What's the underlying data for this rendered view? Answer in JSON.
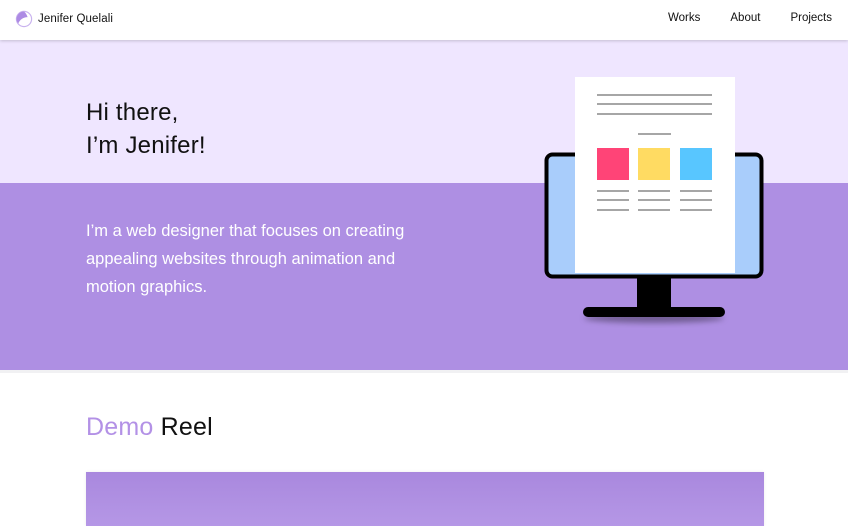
{
  "brand": {
    "name": "Jenifer Quelali",
    "logo_icon": "moon-logo-icon"
  },
  "nav": {
    "links": [
      "Works",
      "About",
      "Projects"
    ]
  },
  "hero": {
    "greeting_line1": "Hi there,",
    "greeting_line2": "I’m Jenifer!",
    "intro": "I’m a web designer that focuses on creating appealing websites through animation and motion graphics.",
    "illustration_icon": "monitor-document-icon"
  },
  "demo_section": {
    "title_accent": "Demo",
    "title_rest": "Reel"
  },
  "colors": {
    "hero_light": "#efe6ff",
    "hero_purple": "#ae8fe3",
    "accent_purple": "#b391e6",
    "swatch_pink": "#ff4477",
    "swatch_yellow": "#ffdb62",
    "swatch_blue": "#58c6ff"
  }
}
